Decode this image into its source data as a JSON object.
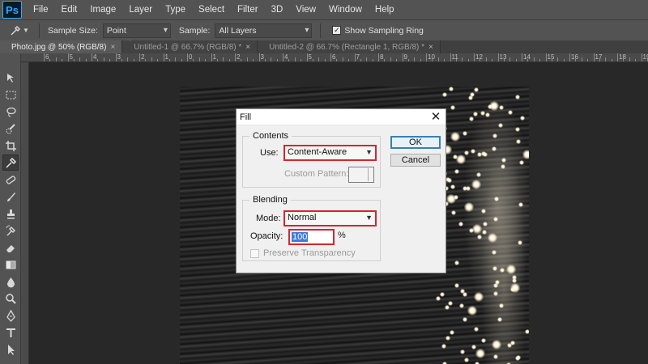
{
  "app": {
    "logo": "Ps",
    "menu": [
      "File",
      "Edit",
      "Image",
      "Layer",
      "Type",
      "Select",
      "Filter",
      "3D",
      "View",
      "Window",
      "Help"
    ]
  },
  "options_bar": {
    "tool_icon": "eyedropper-icon",
    "sample_size_label": "Sample Size:",
    "sample_size_value": "Point Sample",
    "sample_label": "Sample:",
    "sample_value": "All Layers",
    "show_sampling_ring_label": "Show Sampling Ring",
    "show_sampling_ring_checked": true
  },
  "tabs": [
    {
      "label": "Photo.jpg @ 50% (RGB/8)",
      "close": "×",
      "active": true
    },
    {
      "label": "Untitled-1 @ 66.7% (RGB/8) *",
      "close": "×",
      "active": false
    },
    {
      "label": "Untitled-2 @ 66.7% (Rectangle 1, RGB/8) *",
      "close": "×",
      "active": false
    }
  ],
  "ruler": {
    "labels": [
      "6",
      "5",
      "4",
      "3",
      "2",
      "1",
      "0",
      "1",
      "2",
      "3",
      "4",
      "5",
      "6",
      "7",
      "8",
      "9",
      "10",
      "11",
      "12",
      "13",
      "14",
      "15",
      "16",
      "17",
      "18",
      "19"
    ]
  },
  "toolbar": {
    "tools": [
      "move-icon",
      "marquee-icon",
      "lasso-icon",
      "quick-selection-icon",
      "crop-icon",
      "eyedropper-icon",
      "healing-brush-icon",
      "brush-icon",
      "clone-stamp-icon",
      "history-brush-icon",
      "eraser-icon",
      "gradient-icon",
      "blur-icon",
      "dodge-icon",
      "pen-icon",
      "type-icon",
      "path-selection-icon"
    ],
    "active_tool": "eyedropper-icon"
  },
  "dialog": {
    "title": "Fill",
    "close": "✕",
    "contents": {
      "legend": "Contents",
      "use_label": "Use:",
      "use_value": "Content-Aware",
      "custom_pattern_label": "Custom Pattern:"
    },
    "blending": {
      "legend": "Blending",
      "mode_label": "Mode:",
      "mode_value": "Normal",
      "opacity_label": "Opacity:",
      "opacity_value": "100",
      "opacity_unit": "%",
      "preserve_label": "Preserve Transparency",
      "preserve_checked": false
    },
    "ok_label": "OK",
    "cancel_label": "Cancel"
  },
  "colors": {
    "highlight_red": "#d4262d",
    "ui_panel": "#535353",
    "workspace": "#282828"
  }
}
